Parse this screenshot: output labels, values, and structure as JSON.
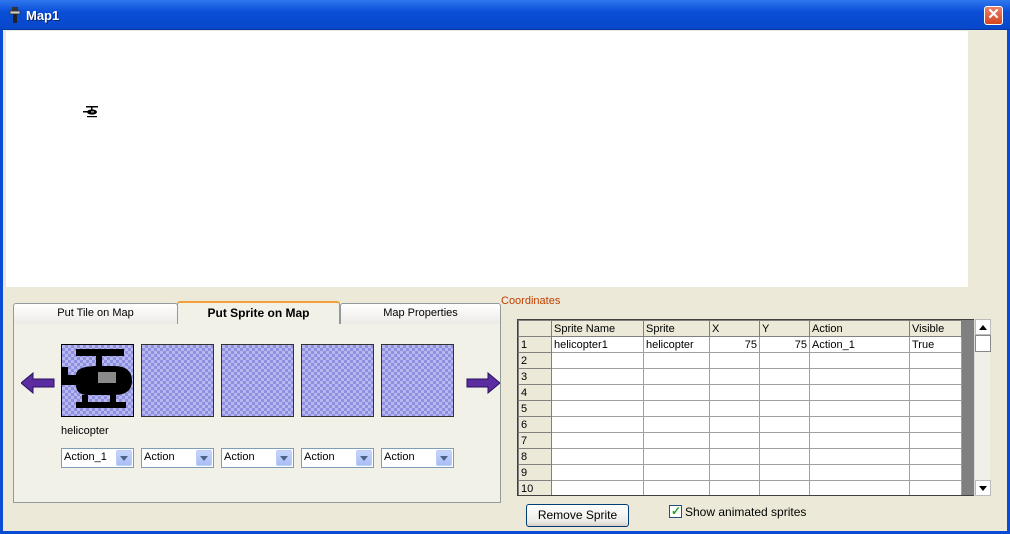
{
  "window": {
    "title": "Map1",
    "close_glyph": "✕",
    "accent_color": "#0a4fd8"
  },
  "map": {
    "sprite_icon": "helicopter-icon"
  },
  "tabs": [
    {
      "label": "Put Tile on Map",
      "active": false
    },
    {
      "label": "Put Sprite on Map",
      "active": true
    },
    {
      "label": "Map Properties",
      "active": false
    }
  ],
  "sprite_palette": {
    "selected_name": "helicopter",
    "actions": [
      "Action_1",
      "Action",
      "Action",
      "Action",
      "Action"
    ]
  },
  "coordinates_label": "Coordinates",
  "grid": {
    "headers": [
      "Sprite Name",
      "Sprite",
      "X",
      "Y",
      "Action",
      "Visible"
    ],
    "rows": [
      {
        "num": "1",
        "name": "helicopter1",
        "sprite": "helicopter",
        "x": "75",
        "y": "75",
        "action": "Action_1",
        "visible": "True"
      },
      {
        "num": "2",
        "name": "",
        "sprite": "",
        "x": "",
        "y": "",
        "action": "",
        "visible": ""
      },
      {
        "num": "3",
        "name": "",
        "sprite": "",
        "x": "",
        "y": "",
        "action": "",
        "visible": ""
      },
      {
        "num": "4",
        "name": "",
        "sprite": "",
        "x": "",
        "y": "",
        "action": "",
        "visible": ""
      },
      {
        "num": "5",
        "name": "",
        "sprite": "",
        "x": "",
        "y": "",
        "action": "",
        "visible": ""
      },
      {
        "num": "6",
        "name": "",
        "sprite": "",
        "x": "",
        "y": "",
        "action": "",
        "visible": ""
      },
      {
        "num": "7",
        "name": "",
        "sprite": "",
        "x": "",
        "y": "",
        "action": "",
        "visible": ""
      },
      {
        "num": "8",
        "name": "",
        "sprite": "",
        "x": "",
        "y": "",
        "action": "",
        "visible": ""
      },
      {
        "num": "9",
        "name": "",
        "sprite": "",
        "x": "",
        "y": "",
        "action": "",
        "visible": ""
      },
      {
        "num": "10",
        "name": "",
        "sprite": "",
        "x": "",
        "y": "",
        "action": "",
        "visible": ""
      }
    ]
  },
  "buttons": {
    "remove_sprite": "Remove Sprite"
  },
  "options": {
    "show_animated_label": "Show animated sprites",
    "show_animated_checked": true,
    "check_glyph": "✓"
  }
}
